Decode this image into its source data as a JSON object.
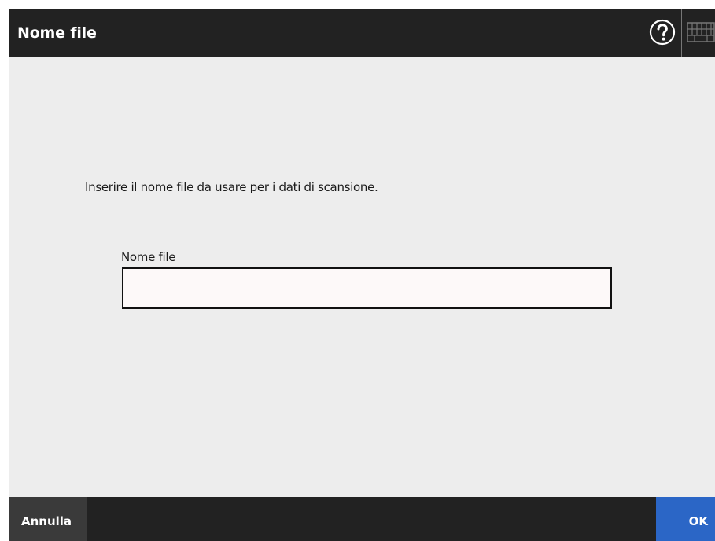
{
  "header": {
    "title": "Nome file",
    "help_icon": "help-icon",
    "keyboard_icon": "keyboard-icon"
  },
  "main": {
    "instruction": "Inserire il nome file da usare per i dati di scansione.",
    "filename_label": "Nome file",
    "filename_value": "",
    "filename_placeholder": ""
  },
  "footer": {
    "cancel_label": "Annulla",
    "ok_label": "OK"
  },
  "colors": {
    "header_bg": "#222222",
    "content_bg": "#ededed",
    "cancel_bg": "#3a3a3a",
    "ok_bg": "#2b66c6"
  }
}
